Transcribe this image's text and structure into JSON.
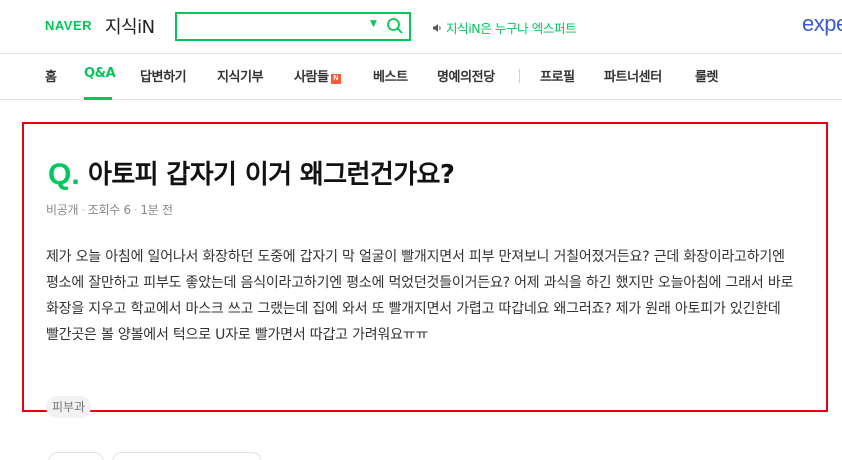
{
  "header": {
    "naver_logo": "NAVER",
    "service_name": "지식iN",
    "search": {
      "value": "",
      "placeholder": ""
    },
    "promo_text": "지식iN은 누구나 엑스퍼트",
    "brand_partial": "expe",
    "accent_color": "#03c75a"
  },
  "nav": {
    "items": [
      {
        "label": "홈"
      },
      {
        "label": "Q&A",
        "active": true
      },
      {
        "label": "답변하기"
      },
      {
        "label": "지식기부"
      },
      {
        "label": "사람들",
        "badge": "N"
      },
      {
        "label": "베스트"
      },
      {
        "label": "명예의전당"
      },
      {
        "label": "프로필"
      },
      {
        "label": "파트너센터"
      },
      {
        "label": "룰렛"
      }
    ]
  },
  "question": {
    "q_mark": "Q.",
    "title": "아토피 갑자기 이거 왜그런건가요?",
    "author": "비공개",
    "views": "조회수 6",
    "time": "1분 전",
    "body": "제가 오늘 아침에 일어나서 화장하던 도중에 갑자기 막 얼굴이 빨개지면서 피부 만져보니 거칠어졌거든요? 근데 화장이라고하기엔 평소에 잘만하고 피부도 좋았는데 음식이라고하기엔 평소에 먹었던것들이거든요? 어제 과식을 하긴 했지만 오늘아침에 그래서 바로 화장을 지우고 학교에서 마스크 쓰고 그랬는데 집에 와서 또 빨개지면서 가렵고 따갑네요 왜그러죠? 제가 원래 아토피가 있긴한데 빨간곳은 볼 양볼에서 턱으로 U자로 빨가면서 따갑고 가려워요ㅠㅠ",
    "tag": "피부과",
    "highlight_color": "#e60012"
  }
}
